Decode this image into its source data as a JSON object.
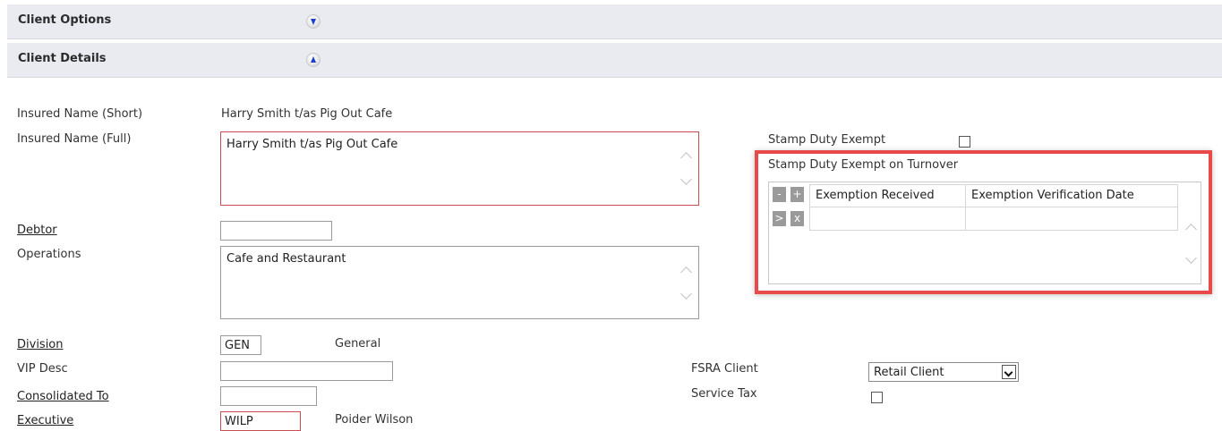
{
  "sections": {
    "client_options": "Client Options",
    "client_details": "Client Details"
  },
  "fields": {
    "insured_short_label": "Insured Name (Short)",
    "insured_short_value": "Harry Smith t/as Pig Out Cafe",
    "insured_full_label": "Insured Name (Full)",
    "insured_full_value": "Harry Smith t/as Pig Out Cafe",
    "debtor_label": "Debtor",
    "debtor_value": "",
    "operations_label": "Operations",
    "operations_value": "Cafe and Restaurant",
    "division_label": "Division",
    "division_value": "GEN",
    "division_desc": "General",
    "vip_desc_label": "VIP Desc",
    "vip_desc_value": "",
    "consolidated_label": "Consolidated To",
    "consolidated_value": "",
    "executive_label": "Executive",
    "executive_value": "WILP",
    "executive_desc": "Poider Wilson"
  },
  "right_panel": {
    "stamp_duty_exempt_label": "Stamp Duty Exempt",
    "stamp_duty_exempt_checked": false,
    "turnover_label": "Stamp Duty Exempt on Turnover",
    "grid": {
      "buttons": {
        "remove": "-",
        "add": "+",
        "expand": ">",
        "delete": "x"
      },
      "columns": [
        "Exemption Received",
        "Exemption Verification Date"
      ]
    },
    "fsra_client_label": "FSRA Client",
    "fsra_client_value": "Retail Client",
    "service_tax_label": "Service Tax",
    "service_tax_checked": false
  },
  "colors": {
    "section_bar": "#e9ebf1",
    "highlight": "#e84a4a",
    "required_border": "#cc4d4d",
    "toggle_arrow": "#1a3ecf"
  }
}
